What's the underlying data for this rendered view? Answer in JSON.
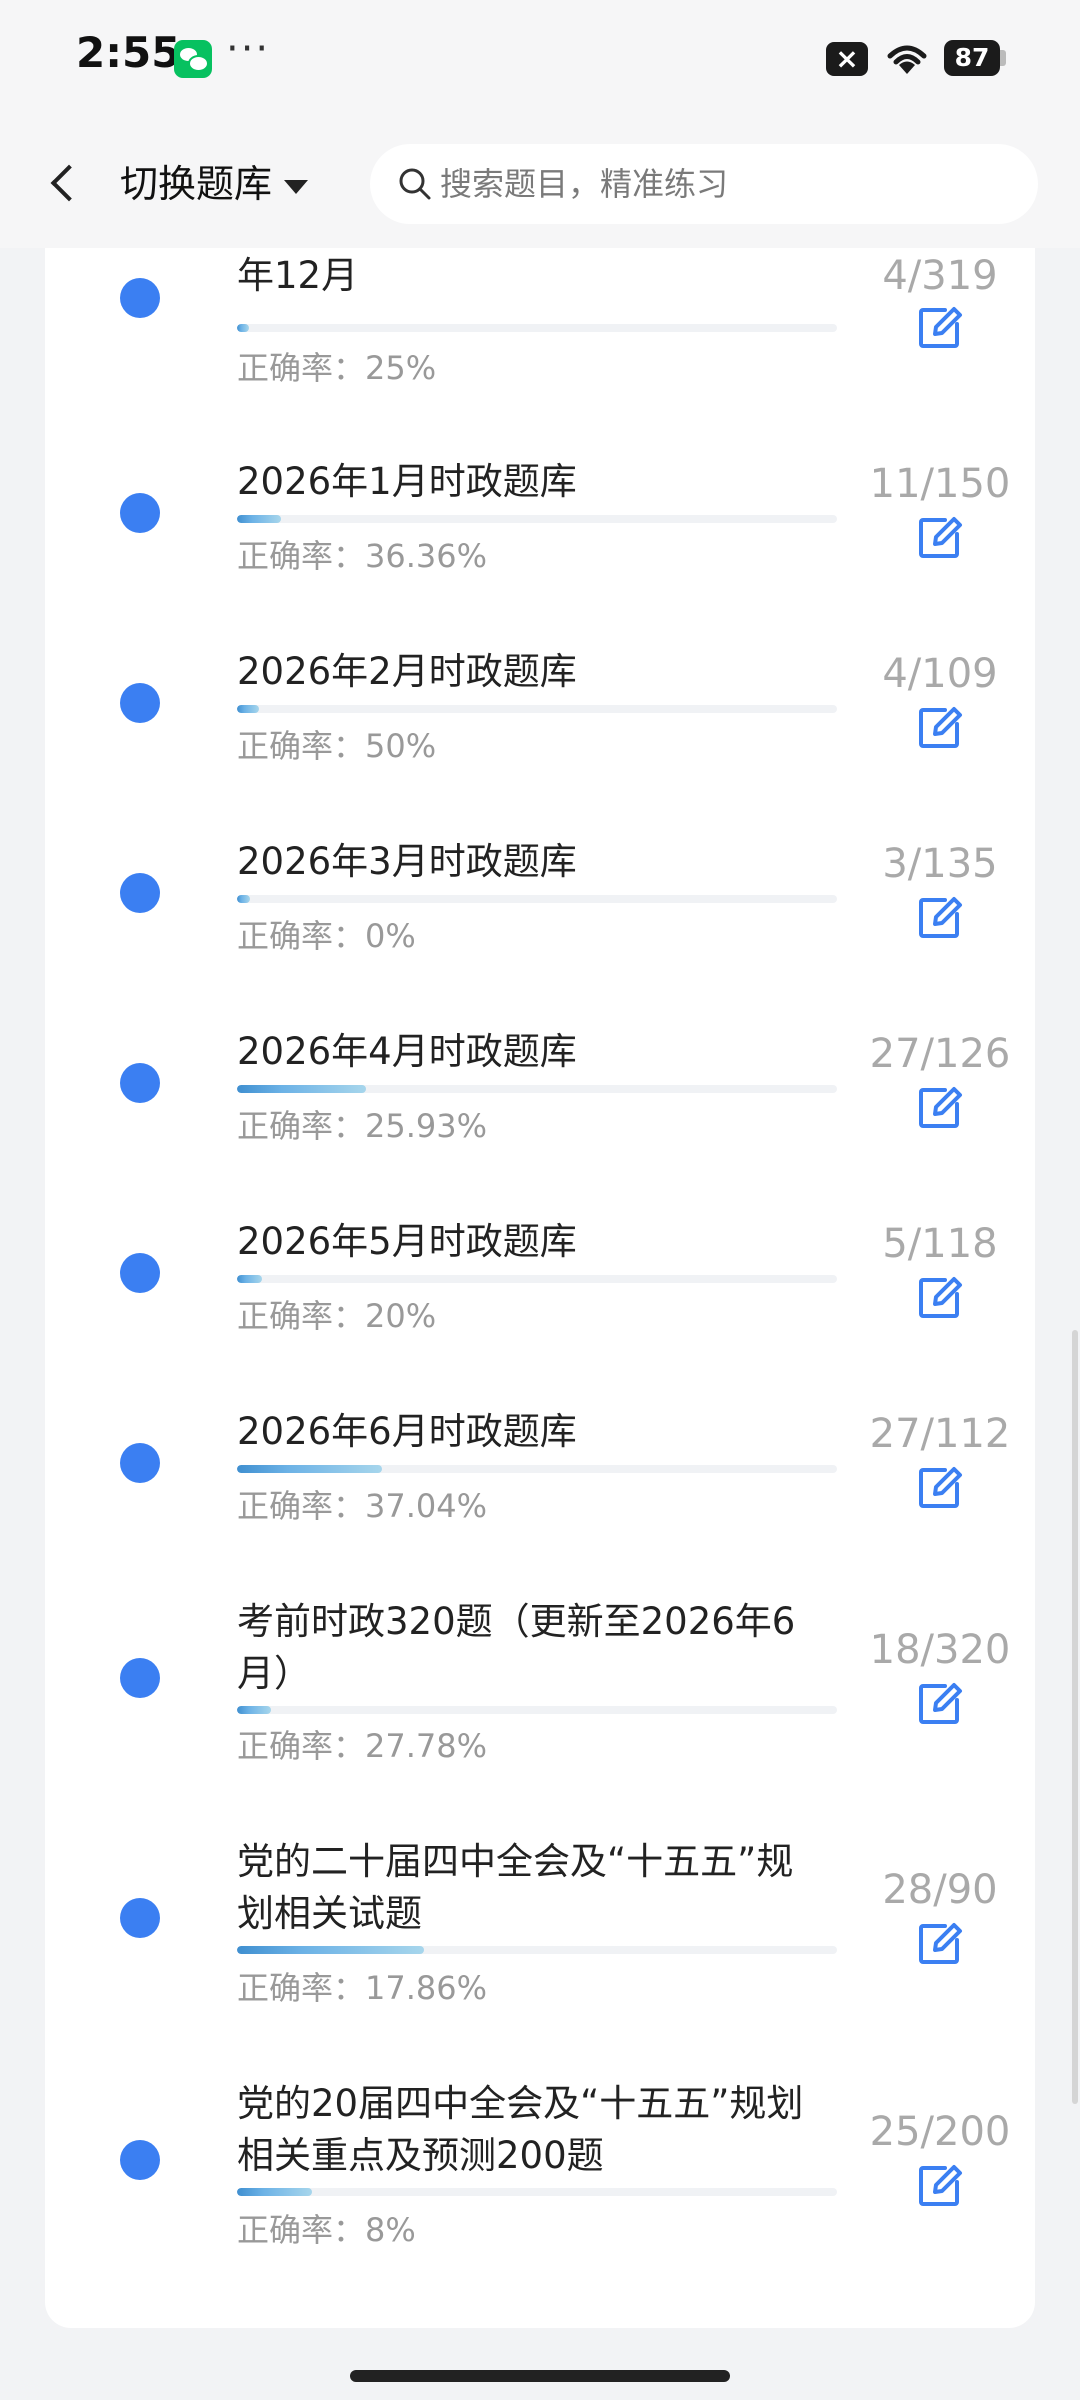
{
  "status_bar": {
    "time": "2:55",
    "dots": "···",
    "battery": "87",
    "icons": [
      "wechat-icon",
      "close-icon",
      "wifi-icon",
      "battery-icon"
    ]
  },
  "header": {
    "switch_label": "切换题库",
    "search_placeholder": "搜索题目，精准练习"
  },
  "colors": {
    "accent_dot": "#3b7ff2",
    "edit_icon": "#3b7ff2",
    "muted_text": "#999999"
  },
  "items": [
    {
      "title": "年12月",
      "count": "4/319",
      "rate": "正确率：25%",
      "progress": 0.0125
    },
    {
      "title": "2026年1月时政题库",
      "count": "11/150",
      "rate": "正确率：36.36%",
      "progress": 0.0733
    },
    {
      "title": "2026年2月时政题库",
      "count": "4/109",
      "rate": "正确率：50%",
      "progress": 0.0367
    },
    {
      "title": "2026年3月时政题库",
      "count": "3/135",
      "rate": "正确率：0%",
      "progress": 0.0222
    },
    {
      "title": "2026年4月时政题库",
      "count": "27/126",
      "rate": "正确率：25.93%",
      "progress": 0.2143
    },
    {
      "title": "2026年5月时政题库",
      "count": "5/118",
      "rate": "正确率：20%",
      "progress": 0.0424
    },
    {
      "title": "2026年6月时政题库",
      "count": "27/112",
      "rate": "正确率：37.04%",
      "progress": 0.2411
    },
    {
      "title": "考前时政320题（更新至2026年6月）",
      "count": "18/320",
      "rate": "正确率：27.78%",
      "progress": 0.0563
    },
    {
      "title": "党的二十届四中全会及“十五五”规划相关试题",
      "count": "28/90",
      "rate": "正确率：17.86%",
      "progress": 0.3111
    },
    {
      "title": "党的20届四中全会及“十五五”规划相关重点及预测200题",
      "count": "25/200",
      "rate": "正确率：8%",
      "progress": 0.125
    }
  ]
}
